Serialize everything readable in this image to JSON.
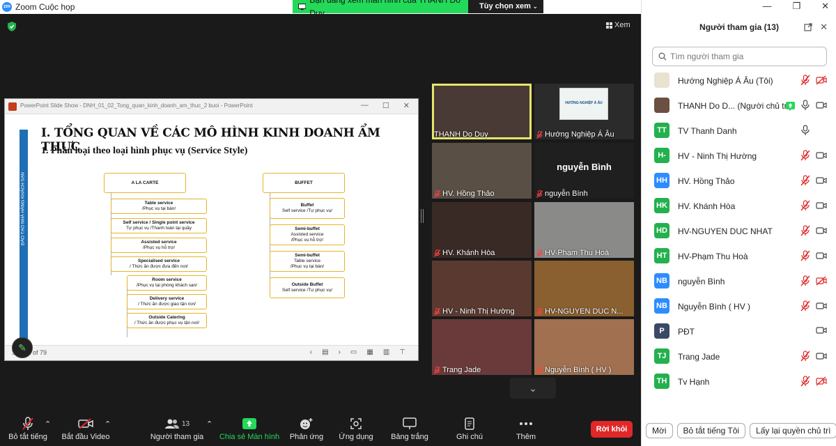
{
  "window": {
    "title": "Zoom Cuộc họp",
    "app_icon": "zm"
  },
  "share_banner": {
    "message": "Bạn đang xem màn hình của THANH Do Duy",
    "options_label": "Tùy chọn xem"
  },
  "view_button": {
    "label": "Xem"
  },
  "slideshow": {
    "window_title": "PowerPoint Slide Show  -  DNH_01_02_Tong_quan_kinh_doanh_am_thuc_2 buoi  -  PowerPoint",
    "sidebar_text": "ĐÀO TẠO NHÀ HÀNG KHÁCH SẠN",
    "heading": "I. TỔNG QUAN VỀ CÁC MÔ HÌNH KINH DOANH ẨM THỰC",
    "subheading": "1.   Phân loại theo loại hình phục vụ (Service Style)",
    "slide_counter": "Slide 1 of 79",
    "left_root": "A LA CARTE",
    "left_items": [
      {
        "title": "Table service",
        "sub": "/Phục vụ tại bàn/"
      },
      {
        "title": "Self service / Single point service",
        "sub": "Tự phục vụ /Thanh toán tại quầy"
      },
      {
        "title": "Assisted service",
        "sub": "/Phục vụ hỗ trợ/"
      },
      {
        "title": "Specialised service",
        "sub": "/ Thức ăn được đưa đến nơi/"
      }
    ],
    "left_sub_items": [
      {
        "title": "Room service",
        "sub": "/Phục vụ tại phòng khách sạn/"
      },
      {
        "title": "Delivery service",
        "sub": "/ Thức ăn được giao tận nơi/"
      },
      {
        "title": "Outside Catering",
        "sub": "/ Thức ăn được phục vụ tận nơi/"
      }
    ],
    "right_root": "BUFFET",
    "right_items": [
      {
        "title": "Buffet",
        "lines": [
          "Self service /Tự phục vụ/"
        ]
      },
      {
        "title": "Semi-buffet",
        "lines": [
          "Assisted service",
          "/Phục vụ hỗ trợ/"
        ]
      },
      {
        "title": "Semi-buffet",
        "lines": [
          "Table service",
          "/Phục vụ tại bàn/"
        ]
      },
      {
        "title": "Outside Buffet",
        "lines": [
          "Self service /Tự phục vụ/"
        ]
      }
    ]
  },
  "video_tiles": [
    {
      "name": "THANH Do Duy",
      "active": true,
      "muted": false,
      "bg": "#4a3a35"
    },
    {
      "name": "Hướng Nghiệp Á Âu",
      "muted": true,
      "bg": "#2b2b2b",
      "logo_text": "HƯỚNG NGHIỆP Á ÂU"
    },
    {
      "name": "HV. Hồng Thảo",
      "muted": true,
      "bg": "#5a4f45"
    },
    {
      "name": "nguyễn Bình",
      "muted": true,
      "bg": "#1f1f1f",
      "center_text": "nguyễn Bình"
    },
    {
      "name": "HV. Khánh Hòa",
      "muted": true,
      "bg": "#3a2a26"
    },
    {
      "name": "HV-Phạm Thu Hoà",
      "muted": true,
      "bg": "#8a8a88"
    },
    {
      "name": "HV - Ninh Thị Hường",
      "muted": true,
      "bg": "#5a3a30"
    },
    {
      "name": "HV-NGUYEN DUC N...",
      "muted": true,
      "bg": "#8a6030"
    },
    {
      "name": "Trang Jade",
      "muted": true,
      "bg": "#6a3a3a"
    },
    {
      "name": "Nguyễn Bình ( HV )",
      "muted": true,
      "bg": "#a07050"
    }
  ],
  "toolbar": {
    "mute": "Bỏ tắt tiếng",
    "video": "Bắt đầu Video",
    "participants": "Người tham gia",
    "participants_count": "13",
    "share": "Chia sẻ Màn hình",
    "reactions": "Phản ứng",
    "apps": "Ứng dụng",
    "whiteboard": "Bảng trắng",
    "notes": "Ghi chú",
    "more": "Thêm",
    "leave": "Rời khỏi"
  },
  "participants_panel": {
    "title": "Người tham gia (13)",
    "search_placeholder": "Tìm người tham gia",
    "people": [
      {
        "initials": "",
        "name": "Hướng Nghiệp Á Âu (Tôi)",
        "color": "#e8e3d0",
        "mic": "off",
        "cam": "off"
      },
      {
        "initials": "",
        "name": "THANH Do D... (Người chủ trì)",
        "color": "#6a5040",
        "mic": "on",
        "cam": "on",
        "sharing": true
      },
      {
        "initials": "TT",
        "name": "TV Thanh Danh",
        "color": "#23b14d",
        "mic": "on",
        "cam": "none"
      },
      {
        "initials": "H-",
        "name": "HV - Ninh Thị Hường",
        "color": "#23b14d",
        "mic": "off",
        "cam": "on"
      },
      {
        "initials": "HH",
        "name": "HV. Hồng Thảo",
        "color": "#2d8cff",
        "mic": "off",
        "cam": "on"
      },
      {
        "initials": "HK",
        "name": "HV. Khánh Hòa",
        "color": "#23b14d",
        "mic": "off",
        "cam": "on"
      },
      {
        "initials": "HD",
        "name": "HV-NGUYEN DUC NHAT",
        "color": "#23b14d",
        "mic": "off",
        "cam": "on"
      },
      {
        "initials": "HT",
        "name": "HV-Phạm Thu Hoà",
        "color": "#23b14d",
        "mic": "off",
        "cam": "on"
      },
      {
        "initials": "NB",
        "name": "nguyễn Bình",
        "color": "#2d8cff",
        "mic": "off",
        "cam": "off"
      },
      {
        "initials": "NB",
        "name": "Nguyễn Bình ( HV )",
        "color": "#2d8cff",
        "mic": "off",
        "cam": "on"
      },
      {
        "initials": "P",
        "name": "PĐT",
        "color": "#3a4a66",
        "mic": "none",
        "cam": "on"
      },
      {
        "initials": "TJ",
        "name": "Trang Jade",
        "color": "#23b14d",
        "mic": "off",
        "cam": "on"
      },
      {
        "initials": "TH",
        "name": "Tv Hạnh",
        "color": "#23b14d",
        "mic": "off",
        "cam": "off"
      }
    ],
    "buttons": {
      "invite": "Mời",
      "mute_all": "Bỏ tắt tiếng Tôi",
      "reclaim_host": "Lấy lại quyền chủ trì"
    }
  },
  "colors": {
    "zoom_blue": "#2d8cff",
    "share_green": "#23d959",
    "leave_red": "#e02828",
    "mute_red": "#e02828"
  }
}
